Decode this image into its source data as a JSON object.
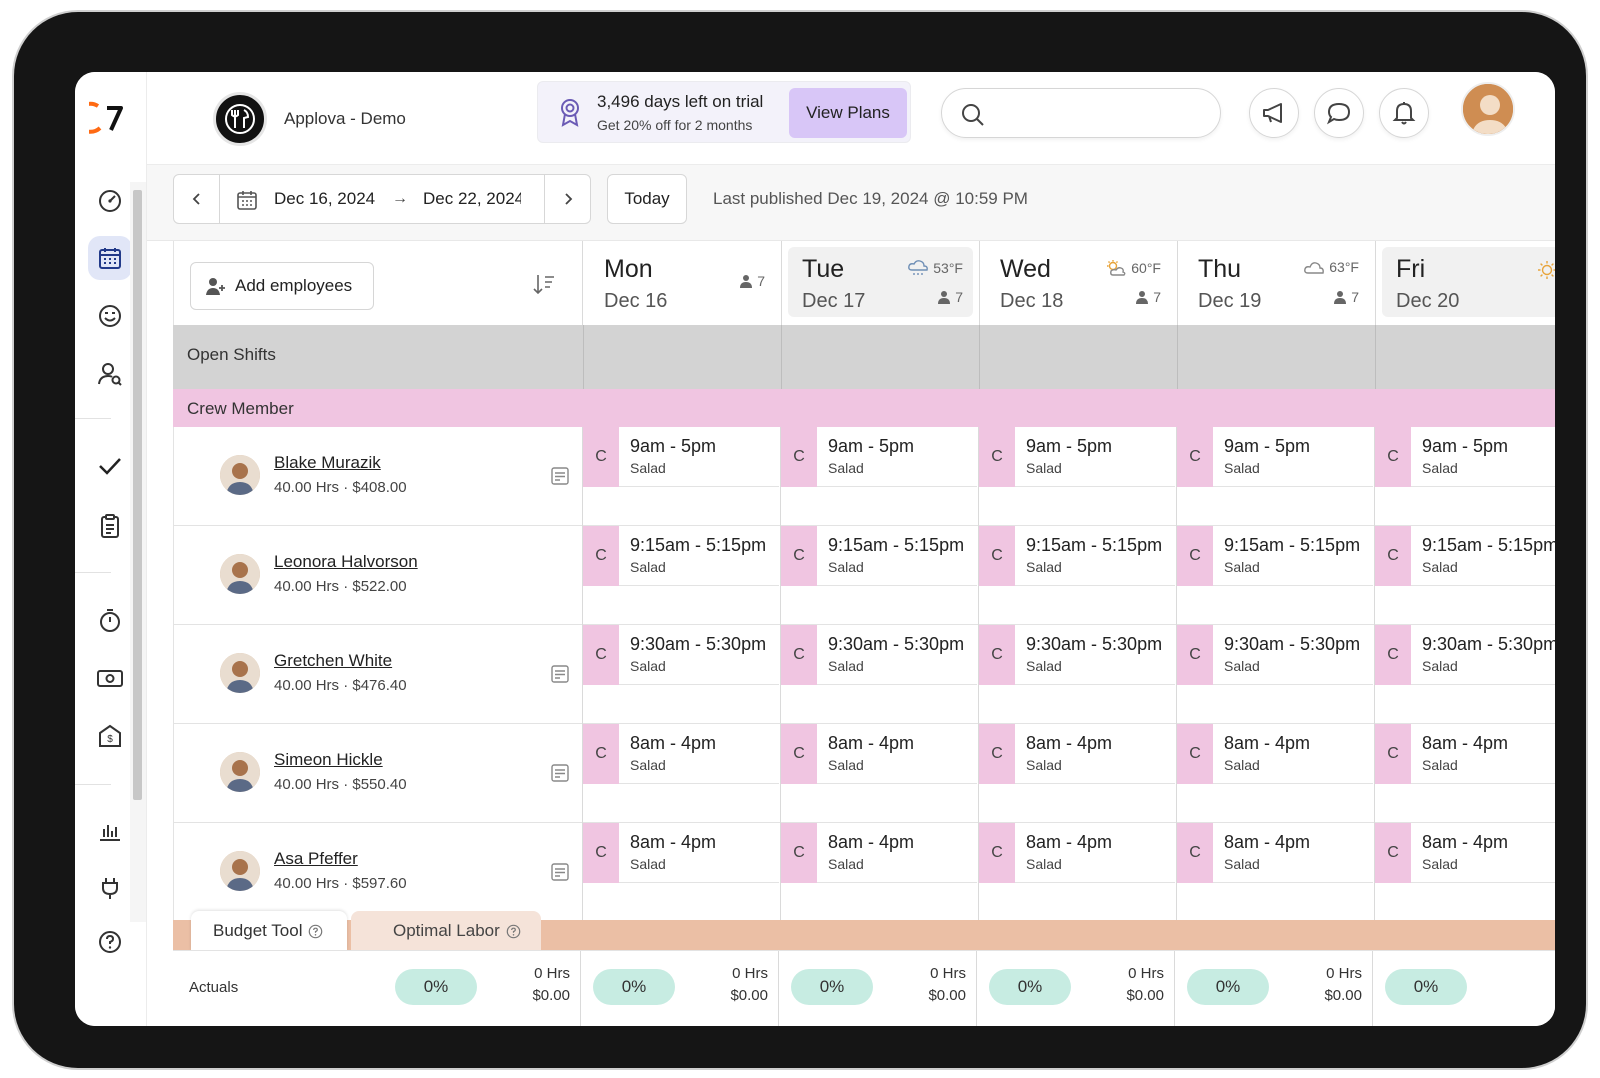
{
  "app": {
    "brand_name": "Applova - Demo"
  },
  "trial": {
    "headline": "3,496 days left on trial",
    "subline": "Get 20% off for 2 months",
    "cta": "View Plans"
  },
  "toolbar": {
    "start_date": "Dec 16, 2024",
    "end_date": "Dec 22, 2024",
    "today_label": "Today",
    "published": "Last published Dec 19, 2024 @ 10:59 PM"
  },
  "grid": {
    "add_employees_label": "Add employees",
    "open_shifts_label": "Open Shifts",
    "role_label": "Crew Member"
  },
  "days": [
    {
      "name": "Mon",
      "date": "Dec 16",
      "weather": "",
      "count": "7"
    },
    {
      "name": "Tue",
      "date": "Dec 17",
      "weather": "53°F",
      "count": "7"
    },
    {
      "name": "Wed",
      "date": "Dec 18",
      "weather": "60°F",
      "count": "7"
    },
    {
      "name": "Thu",
      "date": "Dec 19",
      "weather": "63°F",
      "count": "7"
    },
    {
      "name": "Fri",
      "date": "Dec 20",
      "weather": "",
      "count": ""
    }
  ],
  "employees": [
    {
      "name": "Blake Murazik",
      "meta": "40.00 Hrs · $408.00",
      "shift": "9am - 5pm",
      "role": "Salad",
      "tag": "C",
      "has_note": true
    },
    {
      "name": "Leonora Halvorson",
      "meta": "40.00 Hrs · $522.00",
      "shift": "9:15am - 5:15pm",
      "role": "Salad",
      "tag": "C",
      "has_note": false
    },
    {
      "name": "Gretchen White",
      "meta": "40.00 Hrs · $476.40",
      "shift": "9:30am - 5:30pm",
      "role": "Salad",
      "tag": "C",
      "has_note": true
    },
    {
      "name": "Simeon Hickle",
      "meta": "40.00 Hrs · $550.40",
      "shift": "8am - 4pm",
      "role": "Salad",
      "tag": "C",
      "has_note": true
    },
    {
      "name": "Asa Pfeffer",
      "meta": "40.00 Hrs · $597.60",
      "shift": "8am - 4pm",
      "role": "Salad",
      "tag": "C",
      "has_note": true
    }
  ],
  "budget": {
    "tab_active": "Budget Tool",
    "tab_inactive": "Optimal Labor",
    "actuals_label": "Actuals",
    "actuals": [
      {
        "pct": "0%",
        "hrs": "0 Hrs",
        "amt": "$0.00"
      },
      {
        "pct": "0%",
        "hrs": "0 Hrs",
        "amt": "$0.00"
      },
      {
        "pct": "0%",
        "hrs": "0 Hrs",
        "amt": "$0.00"
      },
      {
        "pct": "0%",
        "hrs": "0 Hrs",
        "amt": "$0.00"
      },
      {
        "pct": "0%",
        "hrs": "0 Hrs",
        "amt": "$0.00"
      },
      {
        "pct": "0%",
        "hrs": "",
        "amt": ""
      }
    ]
  },
  "colors": {
    "accent": "#ff6a13",
    "role_pink": "#f0c5e1",
    "pill_green": "#c7ece2",
    "cta_purple": "#d8c6f7",
    "budget_bar": "#ebbfa5"
  }
}
